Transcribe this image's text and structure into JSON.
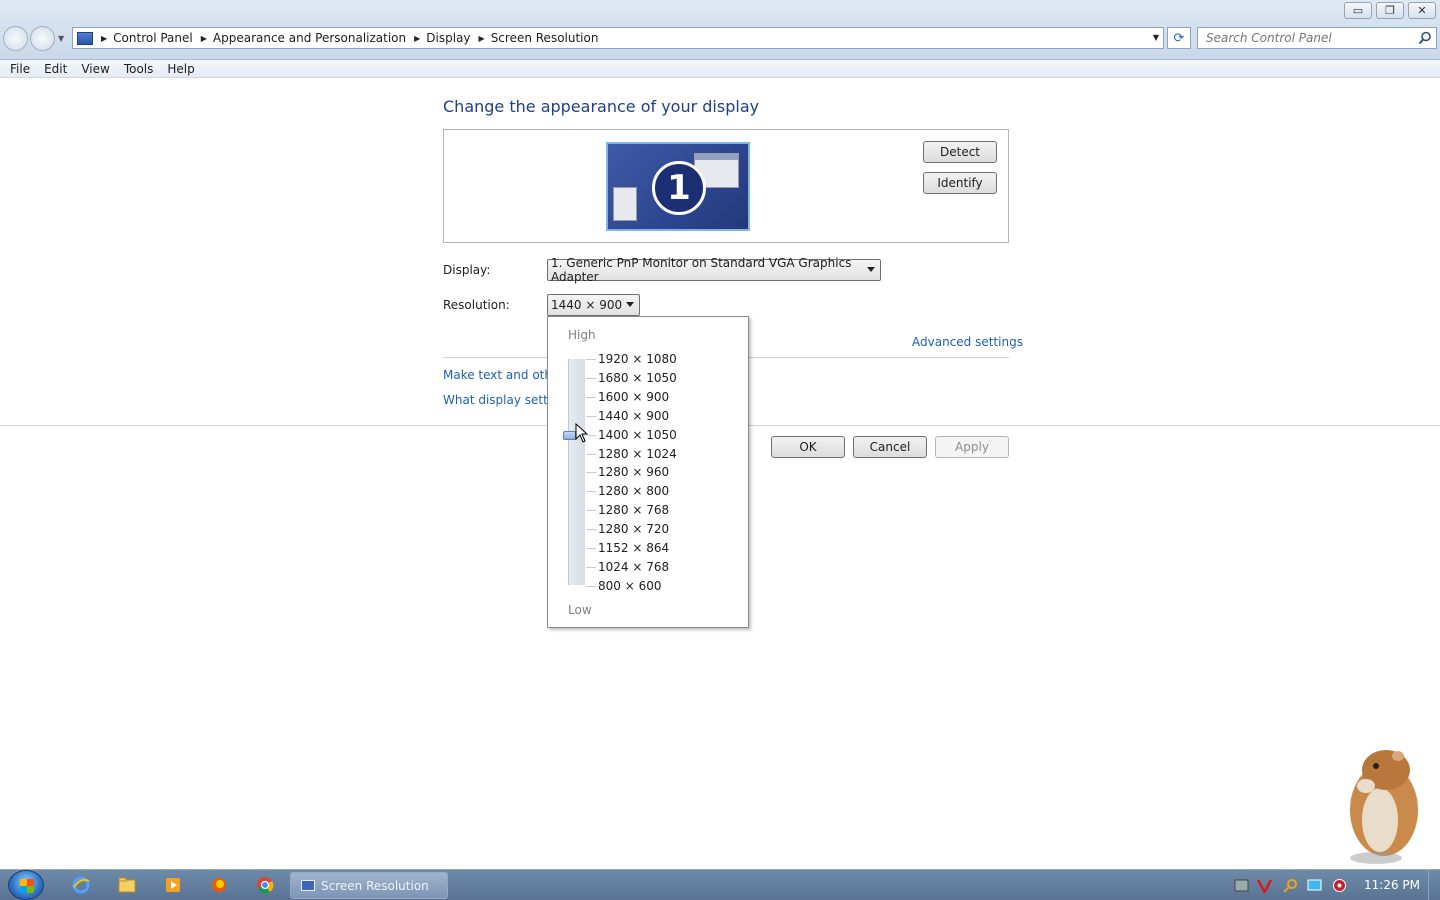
{
  "window": {
    "controls": {
      "minimize": "▭",
      "maximize": "❐",
      "close": "✕"
    }
  },
  "address": {
    "breadcrumbs": [
      "Control Panel",
      "Appearance and Personalization",
      "Display",
      "Screen Resolution"
    ],
    "search_placeholder": "Search Control Panel"
  },
  "menu": [
    "File",
    "Edit",
    "View",
    "Tools",
    "Help"
  ],
  "main": {
    "heading": "Change the appearance of your display",
    "monitor_number": "1",
    "detect_label": "Detect",
    "identify_label": "Identify",
    "display_label": "Display:",
    "display_value": "1. Generic PnP Monitor on Standard VGA Graphics Adapter",
    "resolution_label": "Resolution:",
    "resolution_value": "1440 × 900",
    "advanced_link": "Advanced settings",
    "link_text_size": "Make text and other",
    "link_what_settings": "What display setting",
    "ok_label": "OK",
    "cancel_label": "Cancel",
    "apply_label": "Apply"
  },
  "resolution_dropdown": {
    "high_label": "High",
    "low_label": "Low",
    "options": [
      "1920 × 1080",
      "1680 × 1050",
      "1600 × 900",
      "1440 × 900",
      "1400 × 1050",
      "1280 × 1024",
      "1280 × 960",
      "1280 × 800",
      "1280 × 768",
      "1280 × 720",
      "1152 × 864",
      "1024 × 768",
      "800 × 600"
    ],
    "selected_index": 4
  },
  "taskbar": {
    "active_task": "Screen Resolution",
    "clock": "11:26 PM",
    "pinned_icons": [
      "internet-explorer-icon",
      "explorer-folder-icon",
      "media-player-icon",
      "firefox-icon",
      "chrome-icon"
    ],
    "tray_icons": [
      "network-tray-icon",
      "antivirus-tray-icon",
      "search-tray-icon",
      "monitor-tray-icon",
      "volume-tray-icon"
    ]
  },
  "colors": {
    "link": "#1c60b5",
    "heading": "#1e3f8a",
    "taskbar": "#5a7393"
  }
}
